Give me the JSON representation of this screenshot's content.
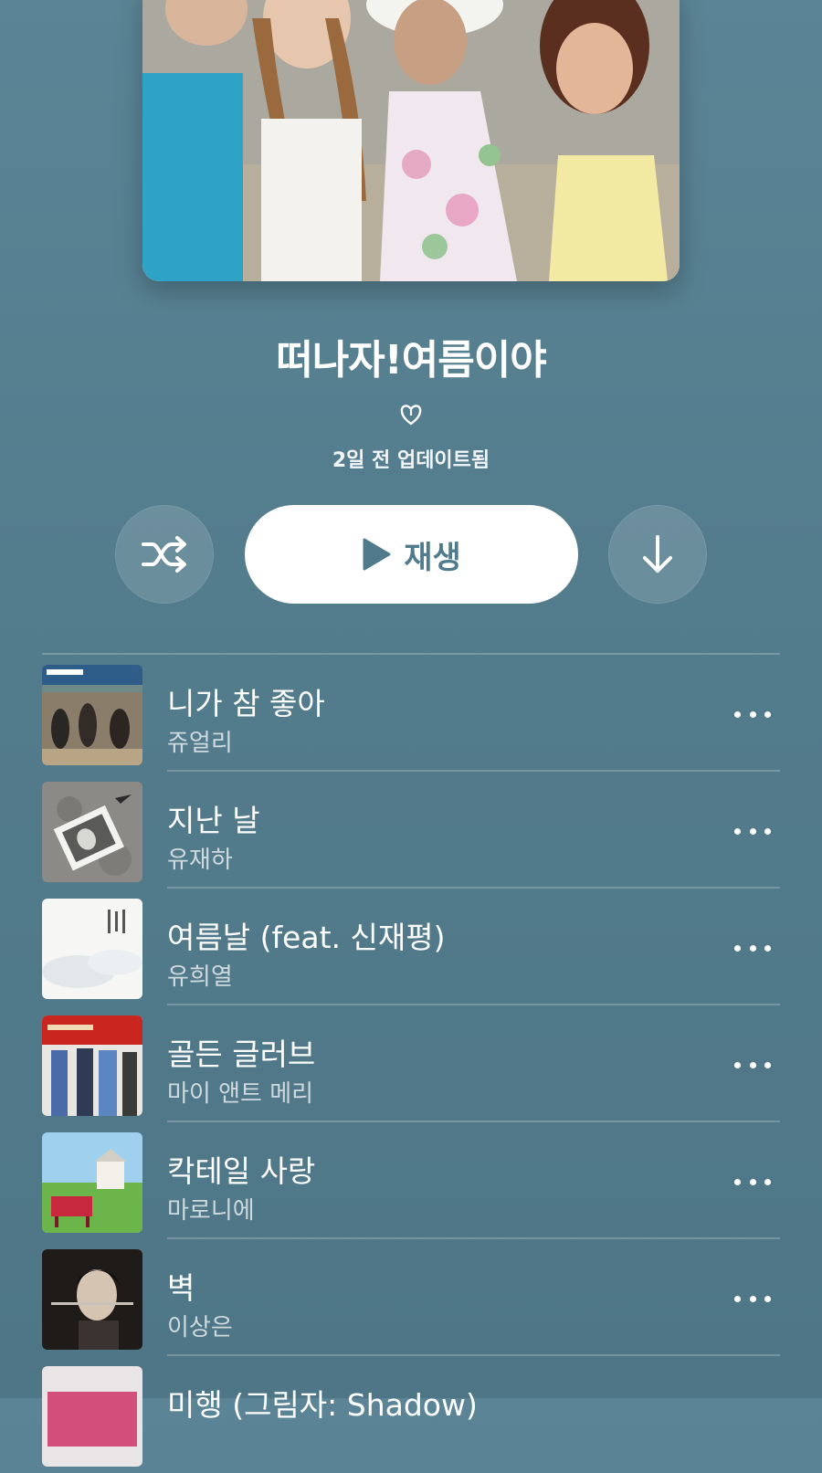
{
  "playlist": {
    "title": "떠나자!여름이야",
    "curator_icon": "curator-heart-icon",
    "updated": "2일 전 업데이트됨"
  },
  "controls": {
    "shuffle_icon": "shuffle-icon",
    "play_label": "재생",
    "play_icon": "play-icon",
    "download_icon": "download-icon"
  },
  "tracks": [
    {
      "title": "니가 참 좋아",
      "artist": "쥬얼리"
    },
    {
      "title": "지난 날",
      "artist": "유재하"
    },
    {
      "title": "여름날 (feat. 신재평)",
      "artist": "유희열"
    },
    {
      "title": "골든 글러브",
      "artist": "마이 앤트 메리"
    },
    {
      "title": "칵테일 사랑",
      "artist": "마로니에"
    },
    {
      "title": "벽",
      "artist": "이상은"
    },
    {
      "title": "미행 (그림자: Shadow)",
      "artist": ""
    }
  ],
  "colors": {
    "background": "#537c8d",
    "accent": "#4f7b8d"
  }
}
